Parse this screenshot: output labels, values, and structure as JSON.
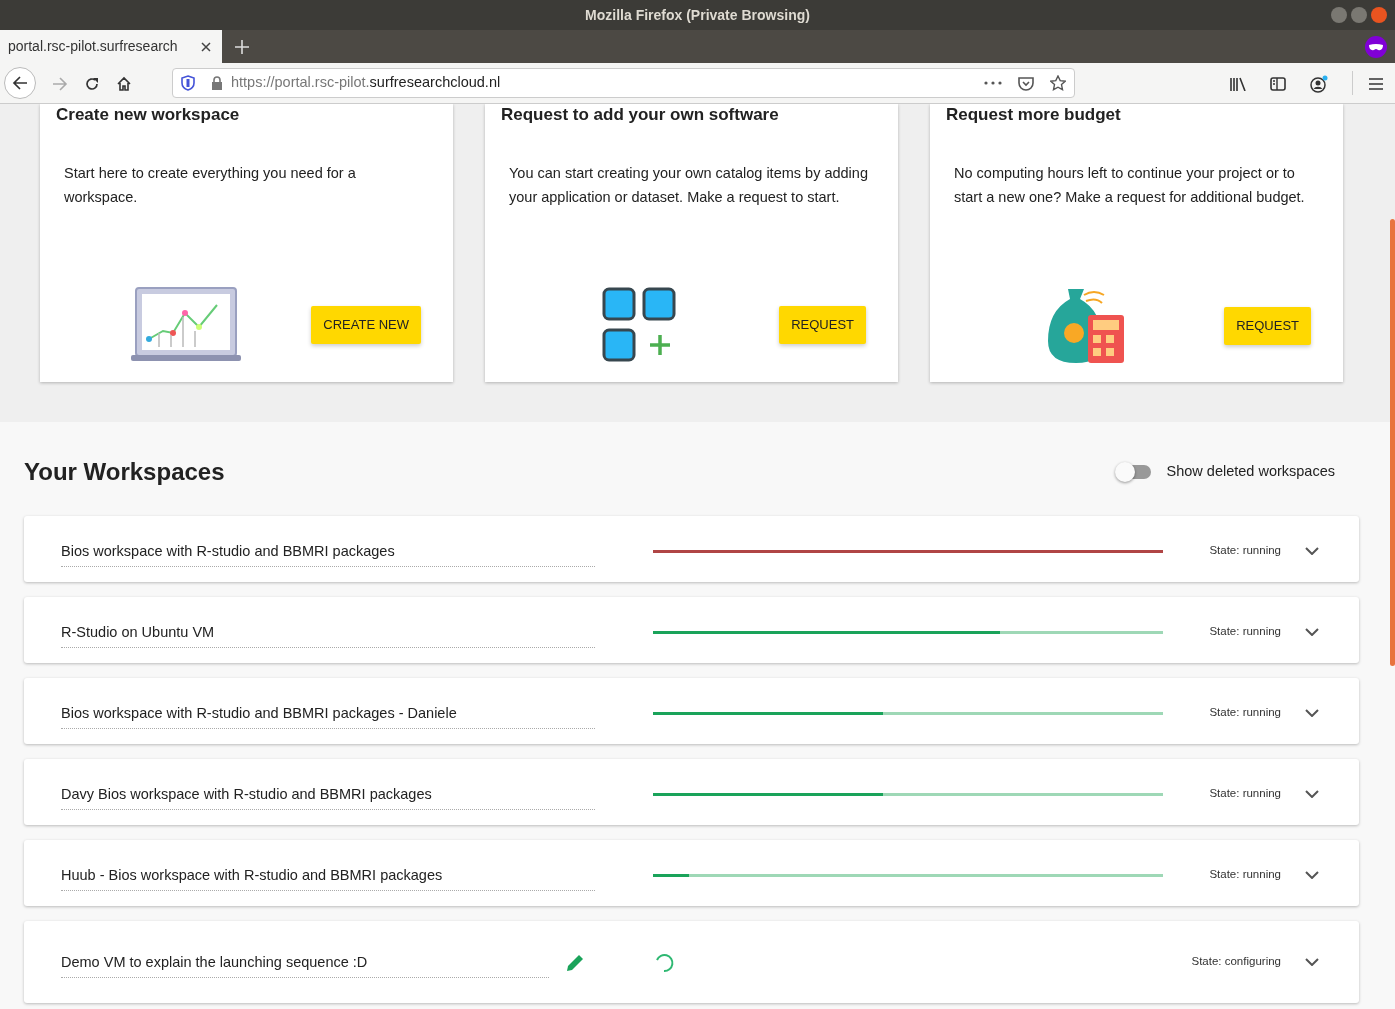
{
  "window": {
    "title": "Mozilla Firefox (Private Browsing)"
  },
  "tabs": [
    {
      "label": "portal.rsc-pilot.surfresearch",
      "selected": true
    }
  ],
  "address_bar": {
    "url_start": "https://portal.rsc-pilot.",
    "url_domain": "surfresearchcloud.nl"
  },
  "cards": [
    {
      "kind": "laptop",
      "title": "Create new workspace",
      "text": "Start here to create everything you need for a workspace.",
      "button": "CREATE NEW"
    },
    {
      "kind": "blocks",
      "title": "Request to add your own software",
      "text": "You can start creating your own catalog items by adding your application or dataset. Make a request to start.",
      "button": "REQUEST"
    },
    {
      "kind": "money",
      "title": "Request more budget",
      "text": "No computing hours left to continue your project or to start a new one? Make a request for additional budget.",
      "button": "REQUEST"
    }
  ],
  "workspaces_section": {
    "heading": "Your Workspaces",
    "toggle": {
      "label": "Show deleted workspaces",
      "on": false
    }
  },
  "workspaces": [
    {
      "kind": "progress",
      "name": "Bios workspace with R-studio and BBMRI packages",
      "level": 1.0,
      "color": "#b04545",
      "state": "State: running"
    },
    {
      "kind": "progress",
      "name": "R-Studio on Ubuntu VM",
      "level": 0.68,
      "color": "#1aa35a",
      "state": "State: running"
    },
    {
      "kind": "progress",
      "name": "Bios workspace with R-studio and BBMRI packages - Daniele",
      "level": 0.45,
      "color": "#1aa35a",
      "state": "State: running"
    },
    {
      "kind": "progress",
      "name": "Davy Bios workspace with R-studio and BBMRI packages",
      "level": 0.45,
      "color": "#1aa35a",
      "state": "State: running"
    },
    {
      "kind": "progress",
      "name": "Huub - Bios workspace with R-studio and BBMRI packages",
      "level": 0.07,
      "color": "#1aa35a",
      "state": "State: running"
    },
    {
      "kind": "spinner",
      "name": "Demo VM to explain the launching sequence :D",
      "state": "State: configuring"
    }
  ]
}
